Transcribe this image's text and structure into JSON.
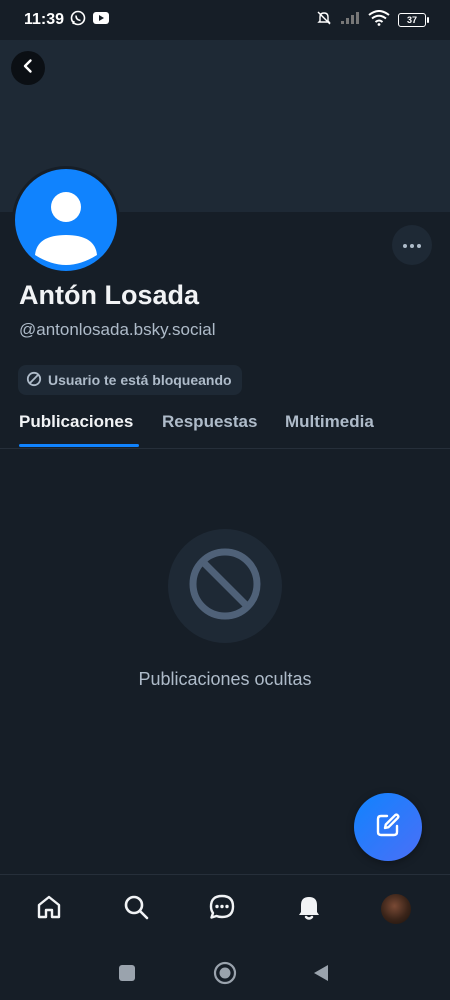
{
  "status_bar": {
    "time": "11:39",
    "battery": "37"
  },
  "profile": {
    "display_name": "Antón Losada",
    "handle": "@antonlosada.bsky.social",
    "blocked_badge": "Usuario te está bloqueando"
  },
  "tabs": [
    {
      "label": "Publicaciones",
      "active": true
    },
    {
      "label": "Respuestas",
      "active": false
    },
    {
      "label": "Multimedia",
      "active": false
    }
  ],
  "empty_state": {
    "text": "Publicaciones ocultas"
  },
  "colors": {
    "accent": "#1083fe",
    "background": "#161e27",
    "banner": "#1e2935",
    "muted_text": "#aebbc9"
  },
  "bottom_nav": [
    "home-icon",
    "search-icon",
    "chat-icon",
    "bell-icon",
    "profile-avatar"
  ]
}
